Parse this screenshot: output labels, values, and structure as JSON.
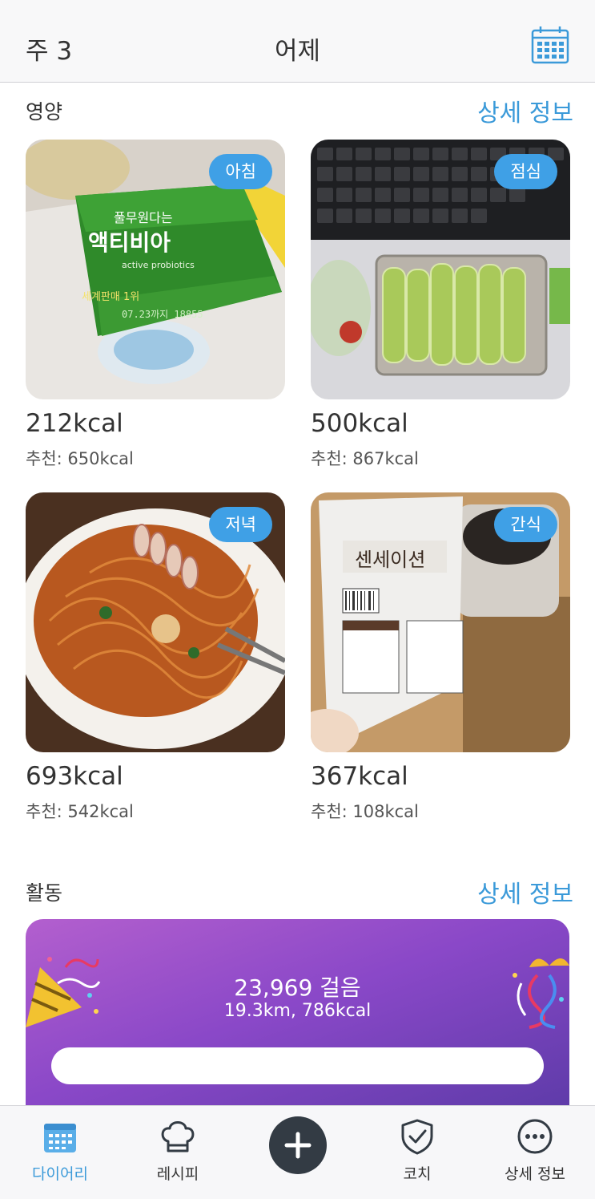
{
  "header": {
    "week": "주 3",
    "title": "어제"
  },
  "nutrition": {
    "section_label": "영양",
    "detail_link": "상세 정보",
    "meals": [
      {
        "badge": "아침",
        "kcal": "212kcal",
        "recommended": "추천: 650kcal"
      },
      {
        "badge": "점심",
        "kcal": "500kcal",
        "recommended": "추천: 867kcal"
      },
      {
        "badge": "저녁",
        "kcal": "693kcal",
        "recommended": "추천: 542kcal"
      },
      {
        "badge": "간식",
        "kcal": "367kcal",
        "recommended": "추천: 108kcal"
      }
    ]
  },
  "activity": {
    "section_label": "활동",
    "detail_link": "상세 정보",
    "steps": "23,969 걸음",
    "distance": "19.3km, 786kcal"
  },
  "tabbar": {
    "items": [
      {
        "label": "다이어리",
        "icon": "calendar-icon",
        "active": true
      },
      {
        "label": "레시피",
        "icon": "chef-hat-icon",
        "active": false
      },
      {
        "label": "",
        "icon": "plus-icon",
        "active": false
      },
      {
        "label": "코치",
        "icon": "shield-check-icon",
        "active": false
      },
      {
        "label": "상세 정보",
        "icon": "more-icon",
        "active": false
      }
    ]
  },
  "colors": {
    "accent": "#3b9ad9",
    "badge": "#3fa0e6",
    "activity_gradient_start": "#b35fce",
    "activity_gradient_end": "#5a3aa6",
    "add_button": "#333b44"
  }
}
